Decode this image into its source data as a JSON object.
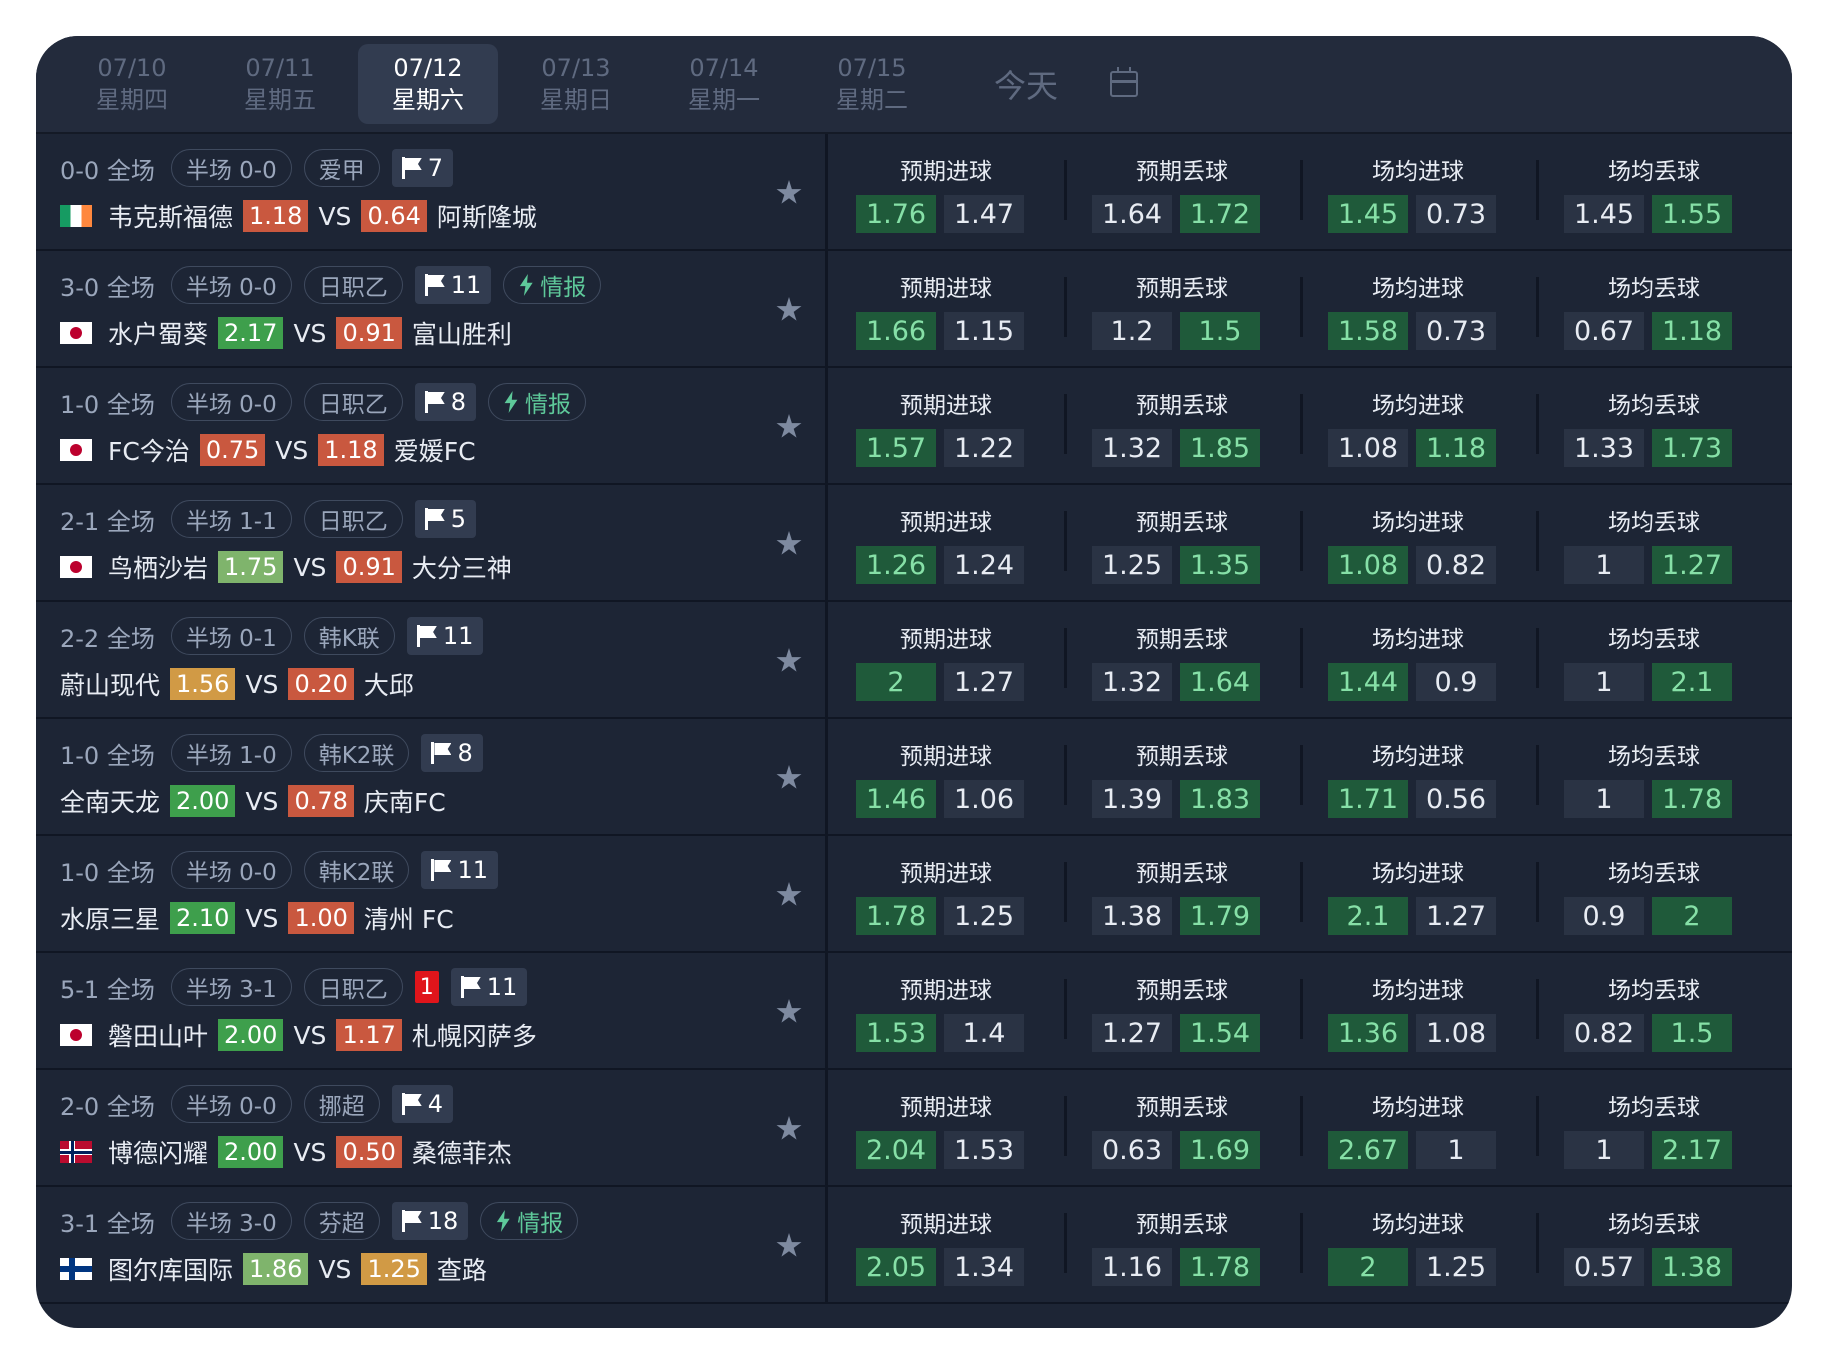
{
  "date_tabs": [
    {
      "date": "07/10",
      "weekday": "星期四",
      "active": false
    },
    {
      "date": "07/11",
      "weekday": "星期五",
      "active": false
    },
    {
      "date": "07/12",
      "weekday": "星期六",
      "active": true
    },
    {
      "date": "07/13",
      "weekday": "星期日",
      "active": false
    },
    {
      "date": "07/14",
      "weekday": "星期一",
      "active": false
    },
    {
      "date": "07/15",
      "weekday": "星期二",
      "active": false
    }
  ],
  "today_label": "今天",
  "stat_titles": [
    "预期进球",
    "预期丢球",
    "场均进球",
    "场均丢球"
  ],
  "vs_label": "VS",
  "intel_label": "情报",
  "matches": [
    {
      "score": "0-0 全场",
      "half": "半场 0-0",
      "league": "爱甲",
      "red": "",
      "corners": "7",
      "intel": false,
      "flag": "ie",
      "home": "韦克斯福德",
      "home_odd": "1.18",
      "home_odd_color": "red",
      "away": "阿斯隆城",
      "away_odd": "0.64",
      "away_odd_color": "red",
      "stats": [
        [
          "1.76",
          "1.47",
          1
        ],
        [
          "1.64",
          "1.72",
          2
        ],
        [
          "1.45",
          "0.73",
          1
        ],
        [
          "1.45",
          "1.55",
          2
        ]
      ]
    },
    {
      "score": "3-0 全场",
      "half": "半场 0-0",
      "league": "日职乙",
      "red": "",
      "corners": "11",
      "intel": true,
      "flag": "jp",
      "home": "水户蜀葵",
      "home_odd": "2.17",
      "home_odd_color": "green",
      "away": "富山胜利",
      "away_odd": "0.91",
      "away_odd_color": "red",
      "stats": [
        [
          "1.66",
          "1.15",
          1
        ],
        [
          "1.2",
          "1.5",
          2
        ],
        [
          "1.58",
          "0.73",
          1
        ],
        [
          "0.67",
          "1.18",
          2
        ]
      ]
    },
    {
      "score": "1-0 全场",
      "half": "半场 0-0",
      "league": "日职乙",
      "red": "",
      "corners": "8",
      "intel": true,
      "flag": "jp",
      "home": "FC今治",
      "home_odd": "0.75",
      "home_odd_color": "red",
      "away": "爱媛FC",
      "away_odd": "1.18",
      "away_odd_color": "red",
      "stats": [
        [
          "1.57",
          "1.22",
          1
        ],
        [
          "1.32",
          "1.85",
          2
        ],
        [
          "1.08",
          "1.18",
          2
        ],
        [
          "1.33",
          "1.73",
          2
        ]
      ]
    },
    {
      "score": "2-1 全场",
      "half": "半场 1-1",
      "league": "日职乙",
      "red": "",
      "corners": "5",
      "intel": false,
      "flag": "jp",
      "home": "鸟栖沙岩",
      "home_odd": "1.75",
      "home_odd_color": "lgreen",
      "away": "大分三神",
      "away_odd": "0.91",
      "away_odd_color": "red",
      "stats": [
        [
          "1.26",
          "1.24",
          1
        ],
        [
          "1.25",
          "1.35",
          2
        ],
        [
          "1.08",
          "0.82",
          1
        ],
        [
          "1",
          "1.27",
          2
        ]
      ]
    },
    {
      "score": "2-2 全场",
      "half": "半场 0-1",
      "league": "韩K联",
      "red": "",
      "corners": "11",
      "intel": false,
      "flag": "",
      "home": "蔚山现代",
      "home_odd": "1.56",
      "home_odd_color": "yellow",
      "away": "大邱",
      "away_odd": "0.20",
      "away_odd_color": "red",
      "stats": [
        [
          "2",
          "1.27",
          1
        ],
        [
          "1.32",
          "1.64",
          2
        ],
        [
          "1.44",
          "0.9",
          1
        ],
        [
          "1",
          "2.1",
          2
        ]
      ]
    },
    {
      "score": "1-0 全场",
      "half": "半场 1-0",
      "league": "韩K2联",
      "red": "",
      "corners": "8",
      "intel": false,
      "flag": "",
      "home": "全南天龙",
      "home_odd": "2.00",
      "home_odd_color": "green",
      "away": "庆南FC",
      "away_odd": "0.78",
      "away_odd_color": "red",
      "stats": [
        [
          "1.46",
          "1.06",
          1
        ],
        [
          "1.39",
          "1.83",
          2
        ],
        [
          "1.71",
          "0.56",
          1
        ],
        [
          "1",
          "1.78",
          2
        ]
      ]
    },
    {
      "score": "1-0 全场",
      "half": "半场 0-0",
      "league": "韩K2联",
      "red": "",
      "corners": "11",
      "intel": false,
      "flag": "",
      "home": "水原三星",
      "home_odd": "2.10",
      "home_odd_color": "green",
      "away": "清州 FC",
      "away_odd": "1.00",
      "away_odd_color": "red",
      "stats": [
        [
          "1.78",
          "1.25",
          1
        ],
        [
          "1.38",
          "1.79",
          2
        ],
        [
          "2.1",
          "1.27",
          1
        ],
        [
          "0.9",
          "2",
          2
        ]
      ]
    },
    {
      "score": "5-1 全场",
      "half": "半场 3-1",
      "league": "日职乙",
      "red": "1",
      "corners": "11",
      "intel": false,
      "flag": "jp",
      "home": "磐田山叶",
      "home_odd": "2.00",
      "home_odd_color": "green",
      "away": "札幌冈萨多",
      "away_odd": "1.17",
      "away_odd_color": "red",
      "stats": [
        [
          "1.53",
          "1.4",
          1
        ],
        [
          "1.27",
          "1.54",
          2
        ],
        [
          "1.36",
          "1.08",
          1
        ],
        [
          "0.82",
          "1.5",
          2
        ]
      ]
    },
    {
      "score": "2-0 全场",
      "half": "半场 0-0",
      "league": "挪超",
      "red": "",
      "corners": "4",
      "intel": false,
      "flag": "no",
      "home": "博德闪耀",
      "home_odd": "2.00",
      "home_odd_color": "green",
      "away": "桑德菲杰",
      "away_odd": "0.50",
      "away_odd_color": "red",
      "stats": [
        [
          "2.04",
          "1.53",
          1
        ],
        [
          "0.63",
          "1.69",
          2
        ],
        [
          "2.67",
          "1",
          1
        ],
        [
          "1",
          "2.17",
          2
        ]
      ]
    },
    {
      "score": "3-1 全场",
      "half": "半场 3-0",
      "league": "芬超",
      "red": "",
      "corners": "18",
      "intel": true,
      "flag": "fi",
      "home": "图尔库国际",
      "home_odd": "1.86",
      "home_odd_color": "lgreen",
      "away": "查路",
      "away_odd": "1.25",
      "away_odd_color": "yellow",
      "stats": [
        [
          "2.05",
          "1.34",
          1
        ],
        [
          "1.16",
          "1.78",
          2
        ],
        [
          "2",
          "1.25",
          1
        ],
        [
          "0.57",
          "1.38",
          2
        ]
      ]
    }
  ]
}
